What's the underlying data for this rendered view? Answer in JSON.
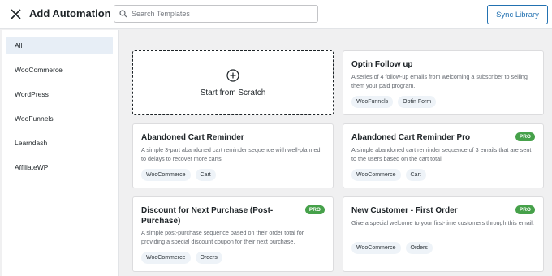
{
  "header": {
    "title": "Add Automation",
    "search_placeholder": "Search Templates",
    "sync_label": "Sync Library"
  },
  "sidebar": {
    "items": [
      {
        "label": "All",
        "active": true
      },
      {
        "label": "WooCommerce",
        "active": false
      },
      {
        "label": "WordPress",
        "active": false
      },
      {
        "label": "WooFunnels",
        "active": false
      },
      {
        "label": "Learndash",
        "active": false
      },
      {
        "label": "AffiliateWP",
        "active": false
      }
    ]
  },
  "scratch": {
    "label": "Start from Scratch"
  },
  "cards": [
    {
      "title": "Optin Follow up",
      "description": "A series of 4 follow-up emails from welcoming a subscriber to selling them your paid program.",
      "tags": [
        "WooFunnels",
        "Optin Form"
      ],
      "pro": false
    },
    {
      "title": "Abandoned Cart Reminder",
      "description": "A simple 3-part abandoned cart reminder sequence with well-planned to delays to recover more carts.",
      "tags": [
        "WooCommerce",
        "Cart"
      ],
      "pro": false
    },
    {
      "title": "Abandoned Cart Reminder Pro",
      "description": "A simple abandoned cart reminder sequence of 3 emails that are sent to the users based on the cart total.",
      "tags": [
        "WooCommerce",
        "Cart"
      ],
      "pro": true
    },
    {
      "title": "Discount for Next Purchase (Post-Purchase)",
      "description": "A simple post-purchase sequence based on their order total for providing a special discount coupon for their next purchase.",
      "tags": [
        "WooCommerce",
        "Orders"
      ],
      "pro": true
    },
    {
      "title": "New Customer - First Order",
      "description": "Give a special welcome to your first-time customers through this email.",
      "tags": [
        "WooCommerce",
        "Orders"
      ],
      "pro": true
    }
  ],
  "pro_label": "PRO",
  "colors": {
    "accent": "#2271b1",
    "pro": "#46a14a",
    "active_bg": "#e7eef6"
  }
}
